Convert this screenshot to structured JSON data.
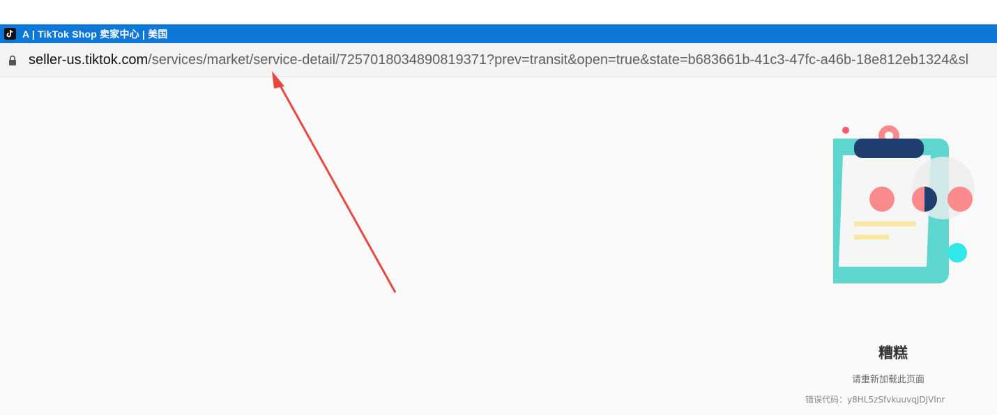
{
  "window": {
    "title": "A | TikTok Shop 卖家中心 | 美国",
    "icon": "tiktok-icon"
  },
  "address_bar": {
    "host": "seller-us.tiktok.com",
    "path": "/services/market/service-detail/7257018034890819371?prev=transit&open=true&state=b683661b-41c3-47fc-a46b-18e812eb1324&sl",
    "icon": "lock-icon"
  },
  "error": {
    "title": "糟糕",
    "subtitle": "请重新加载此页面",
    "code_line": "错误代码：y8HL5zSfvkuuvqJDJVlnr"
  },
  "colors": {
    "titlebar": "#0d78d7",
    "annotation_arrow": "#e8473e",
    "clipboard": "#5ed6d0",
    "clip_top": "#1f3e6e",
    "pink": "#fa8a8c",
    "cyan_dot": "#30e8e8"
  }
}
